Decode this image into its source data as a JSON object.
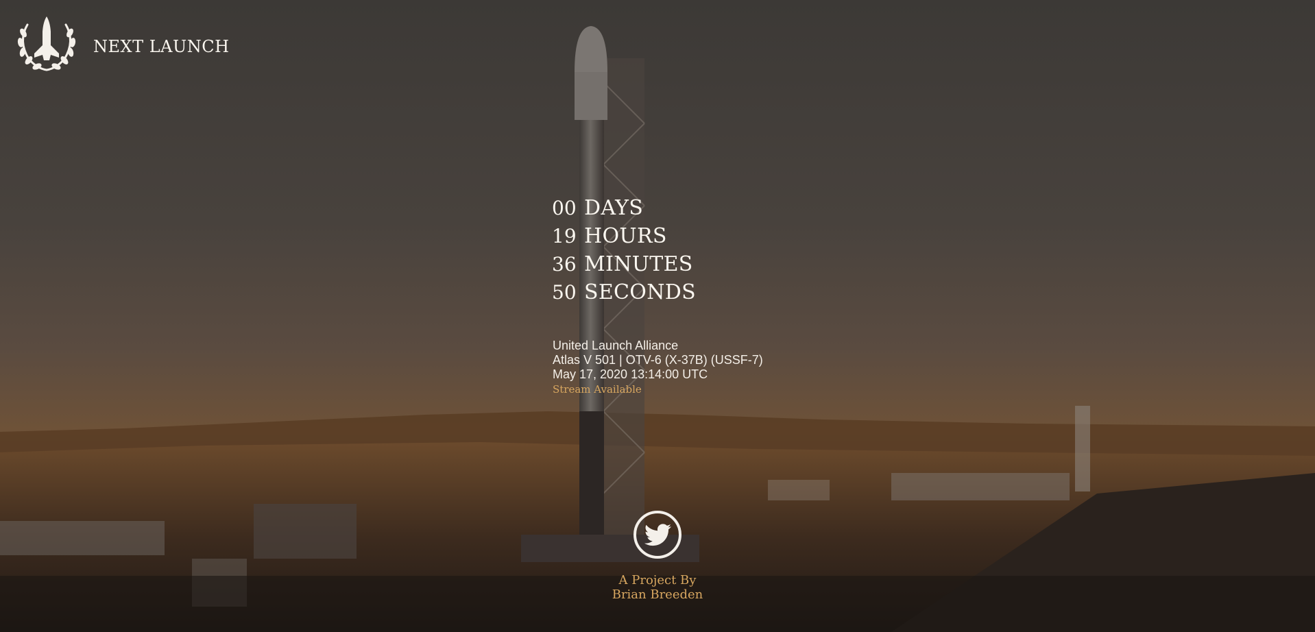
{
  "header": {
    "logo_icon": "shuttle-laurel-icon",
    "title": "NEXT LAUNCH"
  },
  "countdown": {
    "rows": [
      {
        "value": "00",
        "unit": "DAYS"
      },
      {
        "value": "19",
        "unit": "HOURS"
      },
      {
        "value": "36",
        "unit": "MINUTES"
      },
      {
        "value": "50",
        "unit": "SECONDS"
      }
    ]
  },
  "launch": {
    "provider": "United Launch Alliance",
    "mission": "Atlas V 501 | OTV-6 (X-37B) (USSF-7)",
    "datetime": "May 17, 2020 13:14:00 UTC",
    "stream_label": "Stream Available"
  },
  "footer": {
    "social_icon": "twitter-icon",
    "credit_line": "A Project By",
    "author": "Brian Breeden"
  },
  "colors": {
    "accent": "#d8a760",
    "text": "#fbf7f0"
  }
}
